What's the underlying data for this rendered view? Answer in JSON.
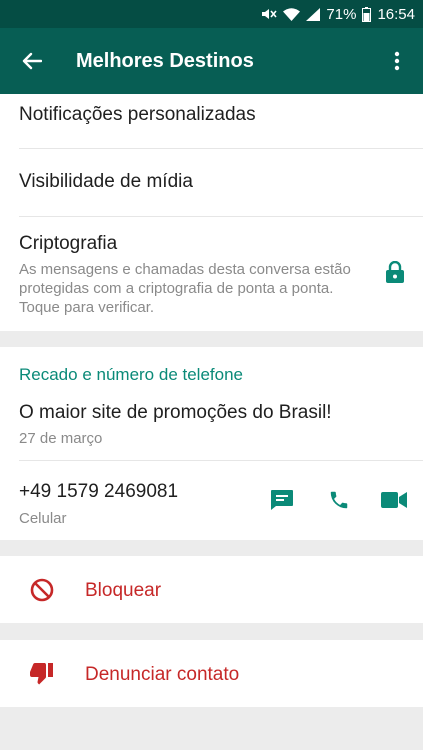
{
  "status": {
    "battery": "71%",
    "time": "16:54"
  },
  "appbar": {
    "title": "Melhores Destinos"
  },
  "settings": {
    "notifications": "Notificações personalizadas",
    "media_visibility": "Visibilidade de mídia",
    "encryption_title": "Criptografia",
    "encryption_text": "As mensagens e chamadas desta conversa estão protegidas com a criptografia de ponta a ponta. Toque para verificar."
  },
  "about": {
    "section_title": "Recado e número de telefone",
    "status_text": "O maior site de promoções do Brasil!",
    "status_date": "27 de março",
    "phone": "+49 1579 2469081",
    "phone_type": "Celular"
  },
  "actions": {
    "block": "Bloquear",
    "report": "Denunciar contato"
  },
  "colors": {
    "appbar": "#075e54",
    "accent": "#0b8a78",
    "danger": "#c62828"
  },
  "icons": {
    "back": "arrow-left",
    "more": "more-vertical",
    "lock": "lock",
    "message": "message",
    "call": "phone",
    "video": "video-camera",
    "block": "block-circle",
    "report": "thumbs-down"
  }
}
